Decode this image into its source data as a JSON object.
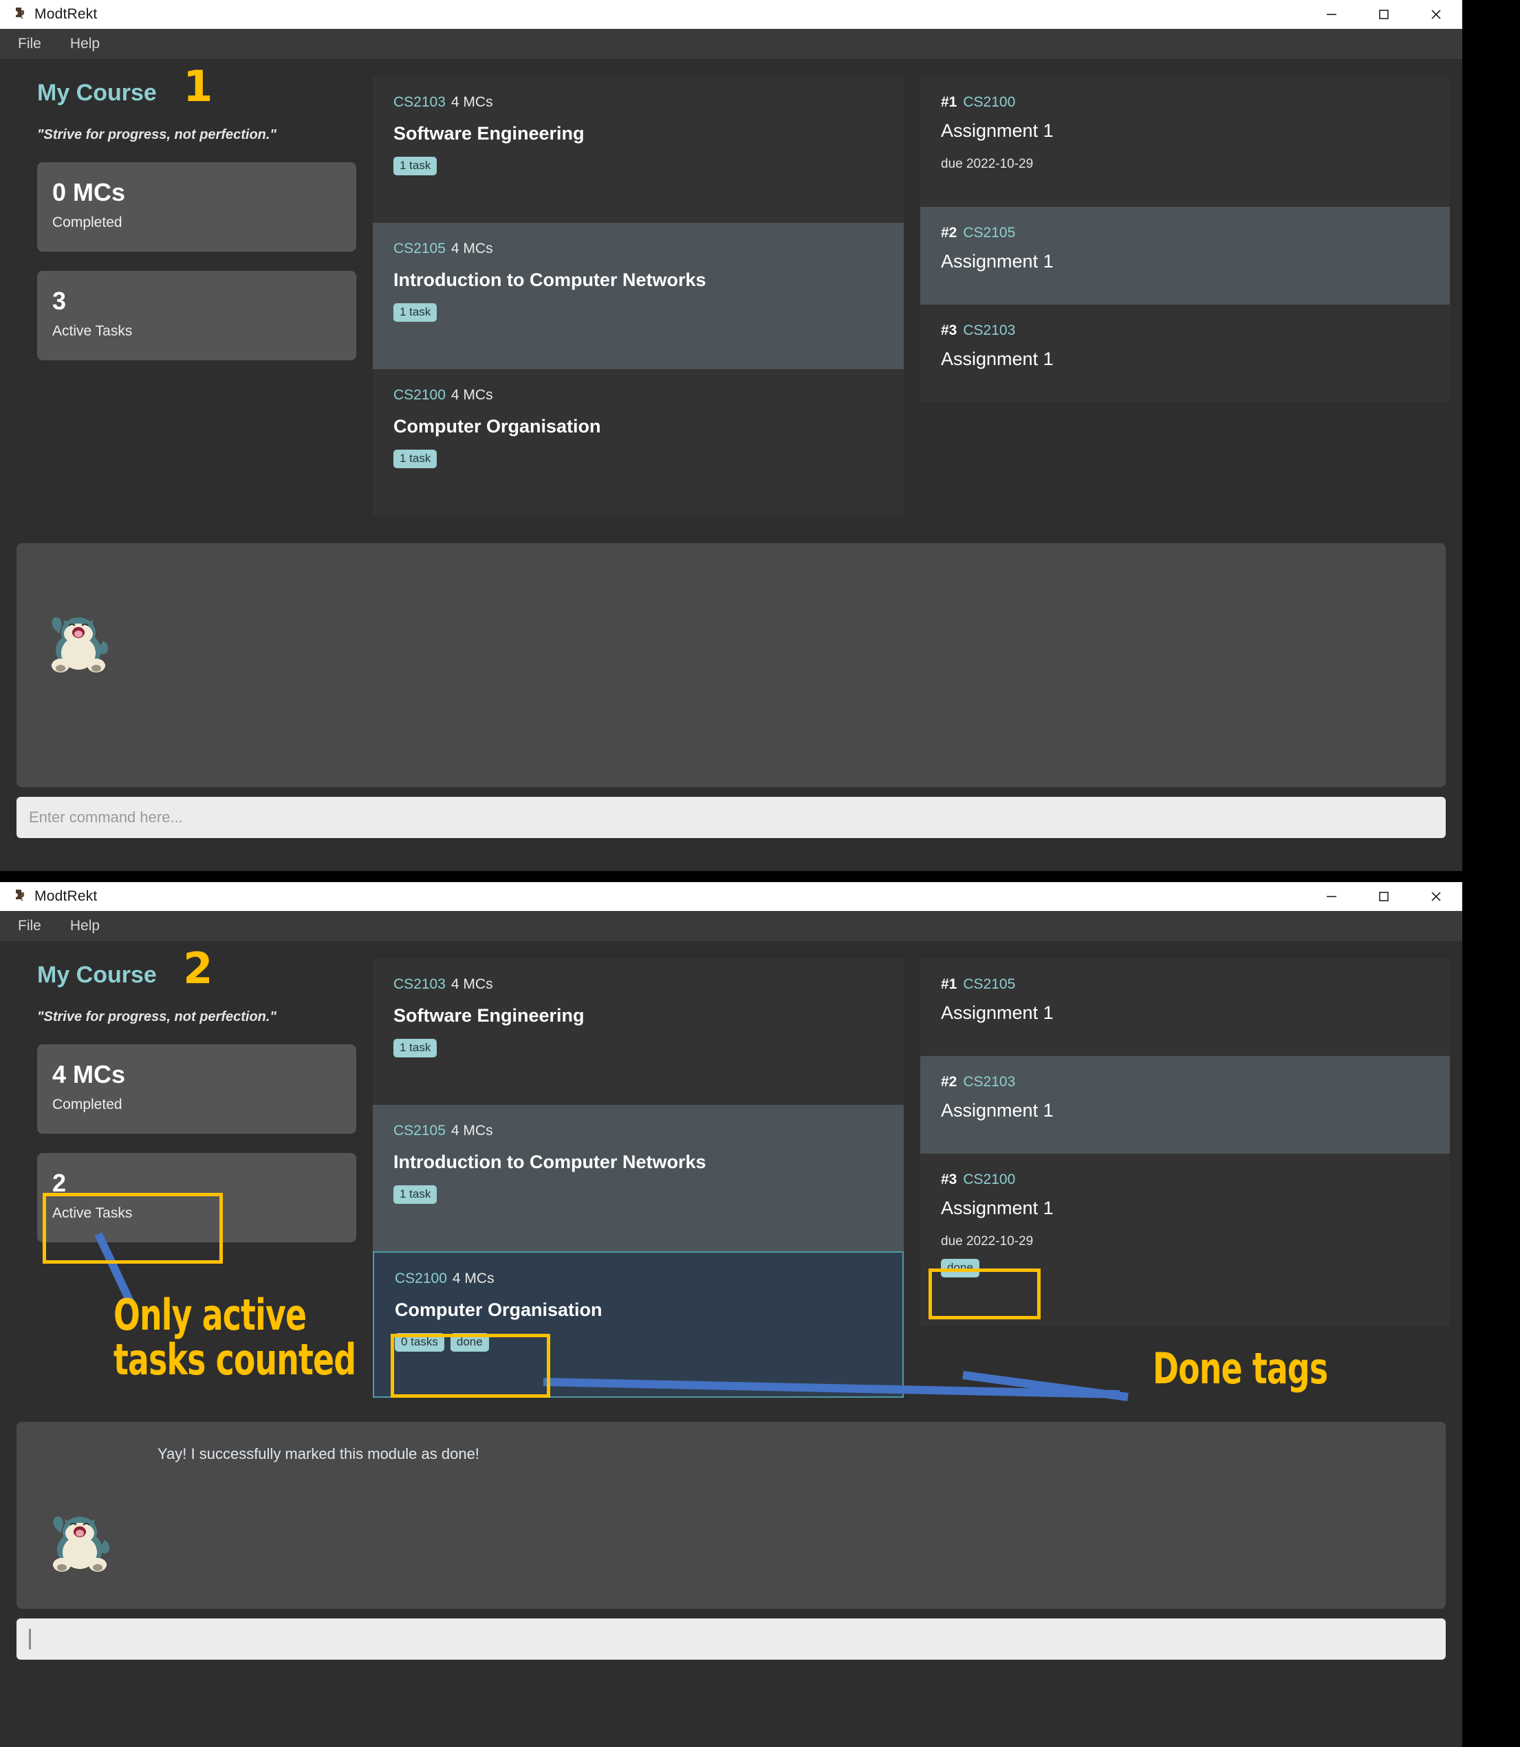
{
  "app": {
    "title": "ModtRekt",
    "menu": [
      "File",
      "Help"
    ],
    "window_controls": [
      "minimize",
      "maximize",
      "close"
    ]
  },
  "windows": [
    {
      "marker": "1",
      "course": {
        "heading": "My Course",
        "quote": "\"Strive for progress, not perfection.\"",
        "stats": [
          {
            "value": "0 MCs",
            "label": "Completed"
          },
          {
            "value": "3",
            "label": "Active Tasks"
          }
        ]
      },
      "modules": [
        {
          "code": "CS2103",
          "mcs": "4 MCs",
          "name": "Software Engineering",
          "tags": [
            "1 task"
          ]
        },
        {
          "code": "CS2105",
          "mcs": "4 MCs",
          "name": "Introduction to Computer Networks",
          "tags": [
            "1 task"
          ]
        },
        {
          "code": "CS2100",
          "mcs": "4 MCs",
          "name": "Computer Organisation",
          "tags": [
            "1 task"
          ]
        }
      ],
      "tasks": [
        {
          "num": "#1",
          "code": "CS2100",
          "name": "Assignment 1",
          "due": "due 2022-10-29",
          "tags": []
        },
        {
          "num": "#2",
          "code": "CS2105",
          "name": "Assignment 1",
          "due": "",
          "tags": []
        },
        {
          "num": "#3",
          "code": "CS2103",
          "name": "Assignment 1",
          "due": "",
          "tags": []
        }
      ],
      "chat": {
        "message": "",
        "avatar": "snorlax-sprite"
      },
      "command": {
        "value": "",
        "placeholder": "Enter command here..."
      }
    },
    {
      "marker": "2",
      "course": {
        "heading": "My Course",
        "quote": "\"Strive for progress, not perfection.\"",
        "stats": [
          {
            "value": "4 MCs",
            "label": "Completed"
          },
          {
            "value": "2",
            "label": "Active Tasks"
          }
        ]
      },
      "modules": [
        {
          "code": "CS2103",
          "mcs": "4 MCs",
          "name": "Software Engineering",
          "tags": [
            "1 task"
          ]
        },
        {
          "code": "CS2105",
          "mcs": "4 MCs",
          "name": "Introduction to Computer Networks",
          "tags": [
            "1 task"
          ]
        },
        {
          "code": "CS2100",
          "mcs": "4 MCs",
          "name": "Computer Organisation",
          "tags": [
            "0 tasks",
            "done"
          ]
        }
      ],
      "tasks": [
        {
          "num": "#1",
          "code": "CS2105",
          "name": "Assignment 1",
          "due": "",
          "tags": []
        },
        {
          "num": "#2",
          "code": "CS2103",
          "name": "Assignment 1",
          "due": "",
          "tags": []
        },
        {
          "num": "#3",
          "code": "CS2100",
          "name": "Assignment 1",
          "due": "due 2022-10-29",
          "tags": [
            "done"
          ]
        }
      ],
      "chat": {
        "message": "Yay! I successfully marked this module as done!",
        "avatar": "snorlax-sprite"
      },
      "command": {
        "value": "",
        "placeholder": ""
      }
    }
  ],
  "annotations": {
    "active_tasks_note": "Only active\ntasks counted",
    "done_tags_note": "Done tags",
    "colors": {
      "highlight": "#ffc000",
      "pointer": "#4472c4",
      "accent_teal": "#8ecfd2"
    }
  }
}
